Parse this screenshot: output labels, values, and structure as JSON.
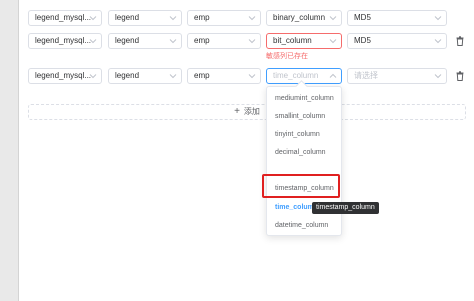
{
  "rows": [
    {
      "source": "legend_mysql...",
      "database": "legend",
      "table": "emp",
      "column": "binary_column",
      "algorithm": "MD5"
    },
    {
      "source": "legend_mysql...",
      "database": "legend",
      "table": "emp",
      "column": "bit_column",
      "algorithm": "MD5",
      "error": "敏感列已存在"
    },
    {
      "source": "legend_mysql...",
      "database": "legend",
      "table": "emp",
      "column_placeholder": "time_column",
      "algorithm_placeholder": "请选择"
    }
  ],
  "add_button": {
    "icon": "plus-icon",
    "label": "添加"
  },
  "dropdown": {
    "options": [
      "mediumint_column",
      "smallint_column",
      "tinyint_column",
      "decimal_column",
      "",
      "timestamp_column",
      "time_column",
      "datetime_column"
    ],
    "selected": "time_column",
    "highlighted": "timestamp_column"
  },
  "tooltip": "timestamp_column",
  "colors": {
    "error": "#f56c6c",
    "highlight_box": "#e02020",
    "accent": "#409eff"
  }
}
